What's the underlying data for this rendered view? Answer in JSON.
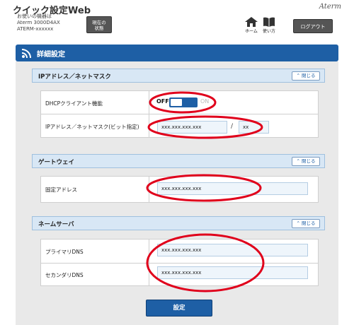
{
  "header": {
    "app_title": "クイック設定Web",
    "device_line1": "お使いの機器は",
    "device_line2": "Aterm 3000D4AX",
    "device_line3": "ATERM-xxxxxx",
    "status_button_line1": "現在の",
    "status_button_line2": "状態",
    "brand": "Aterm",
    "home_label": "ホーム",
    "guide_label": "使い方",
    "logout_label": "ログアウト"
  },
  "section": {
    "title": "詳細設定"
  },
  "groups": {
    "ip": {
      "title": "IPアドレス／ネットマスク",
      "collapse_label": "閉じる",
      "dhcp_label": "DHCPクライアント機能",
      "toggle_off": "OFF",
      "toggle_on": "ON",
      "ipmask_label": "IPアドレス／ネットマスク(ビット指定)",
      "ip_value": "xxx.xxx.xxx.xxx",
      "slash": "/",
      "mask_value": "xx"
    },
    "gateway": {
      "title": "ゲートウェイ",
      "collapse_label": "閉じる",
      "fixed_label": "固定アドレス",
      "fixed_value": "xxx.xxx.xxx.xxx"
    },
    "dns": {
      "title": "ネームサーバ",
      "collapse_label": "閉じる",
      "primary_label": "プライマリDNS",
      "primary_value": "xxx.xxx.xxx.xxx",
      "secondary_label": "セカンダリDNS",
      "secondary_value": "xxx.xxx.xxx.xxx"
    }
  },
  "submit_label": "設定",
  "colors": {
    "accent": "#1e5fa5",
    "annotation": "#e0001b"
  }
}
